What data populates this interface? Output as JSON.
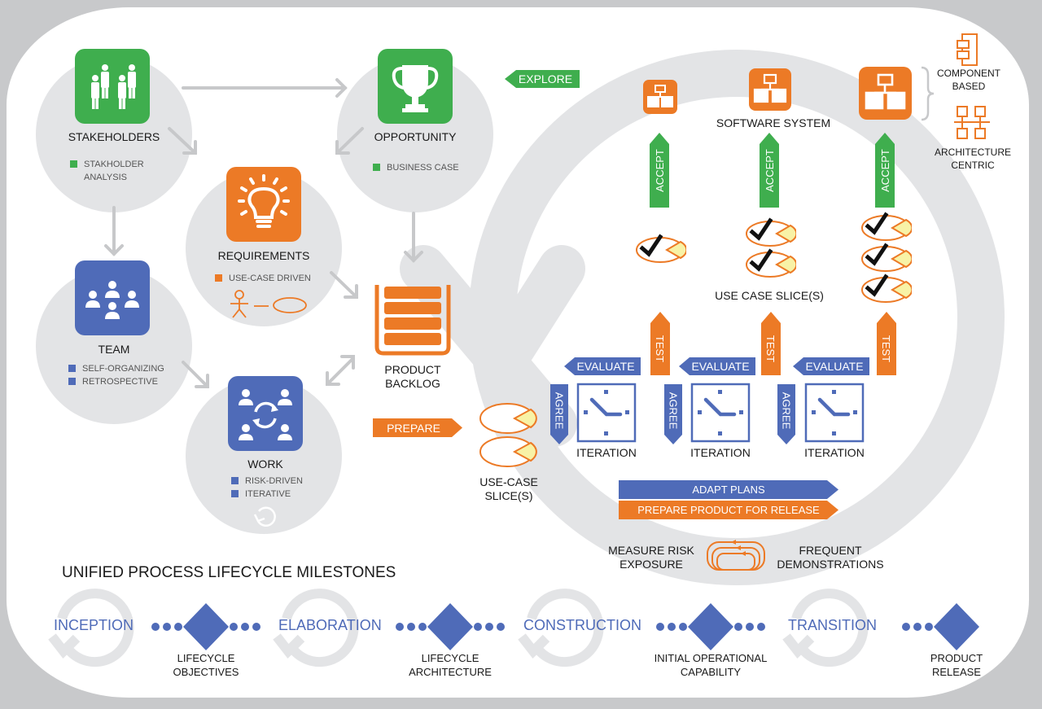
{
  "colors": {
    "green": "#3fae4e",
    "orange": "#ec7a26",
    "blue": "#4f6bb8",
    "gray_circle": "#e3e4e6",
    "slice_fill": "#f8f2a6",
    "frame_gray": "#c8c9cb"
  },
  "nodes": {
    "stakeholders": {
      "title": "STAKEHOLDERS",
      "icon": "people-group-icon",
      "bullets": [
        "STAKHOLDER",
        "ANALYSIS"
      ]
    },
    "opportunity": {
      "title": "OPPORTUNITY",
      "icon": "trophy-icon",
      "bullets": [
        "BUSINESS CASE"
      ]
    },
    "requirements": {
      "title": "REQUIREMENTS",
      "icon": "lightbulb-icon",
      "bullets": [
        "USE-CASE DRIVEN"
      ]
    },
    "team": {
      "title": "TEAM",
      "icon": "team-icon",
      "bullets": [
        "SELF-ORGANIZING",
        "RETROSPECTIVE"
      ]
    },
    "work": {
      "title": "WORK",
      "icon": "work-cycle-icon",
      "bullets": [
        "RISK-DRIVEN",
        "ITERATIVE"
      ]
    }
  },
  "backlog": {
    "title_line1": "PRODUCT",
    "title_line2": "BACKLOG"
  },
  "flow": {
    "explore": "EXPLORE",
    "prepare": "PREPARE",
    "use_case_slices_left": [
      "USE-CASE",
      "SLICE(S)"
    ],
    "software_system": "SOFTWARE SYSTEM",
    "use_case_slices_mid": "USE CASE SLICE(S)",
    "component_based": [
      "COMPONENT",
      "BASED"
    ],
    "architecture_centric": [
      "ARCHITECTURE",
      "CENTRIC"
    ],
    "accept": "ACCEPT",
    "test": "TEST",
    "evaluate": "EVALUATE",
    "agree": "AGREE",
    "iteration": "ITERATION",
    "adapt_plans": "ADAPT PLANS",
    "prepare_release": "PREPARE PRODUCT FOR RELEASE",
    "measure_risk": [
      "MEASURE RISK",
      "EXPOSURE"
    ],
    "frequent_demos": [
      "FREQUENT",
      "DEMONSTRATIONS"
    ],
    "iterations": [
      {
        "completed_slices": 1
      },
      {
        "completed_slices": 2
      },
      {
        "completed_slices": 3
      }
    ]
  },
  "milestones": {
    "title": "UNIFIED PROCESS LIFECYCLE MILESTONES",
    "phases": [
      "INCEPTION",
      "ELABORATION",
      "CONSTRUCTION",
      "TRANSITION"
    ],
    "markers": [
      [
        "LIFECYCLE",
        "OBJECTIVES"
      ],
      [
        "LIFECYCLE",
        "ARCHITECTURE"
      ],
      [
        "INITIAL OPERATIONAL",
        "CAPABILITY"
      ],
      [
        "PRODUCT",
        "RELEASE"
      ]
    ]
  }
}
